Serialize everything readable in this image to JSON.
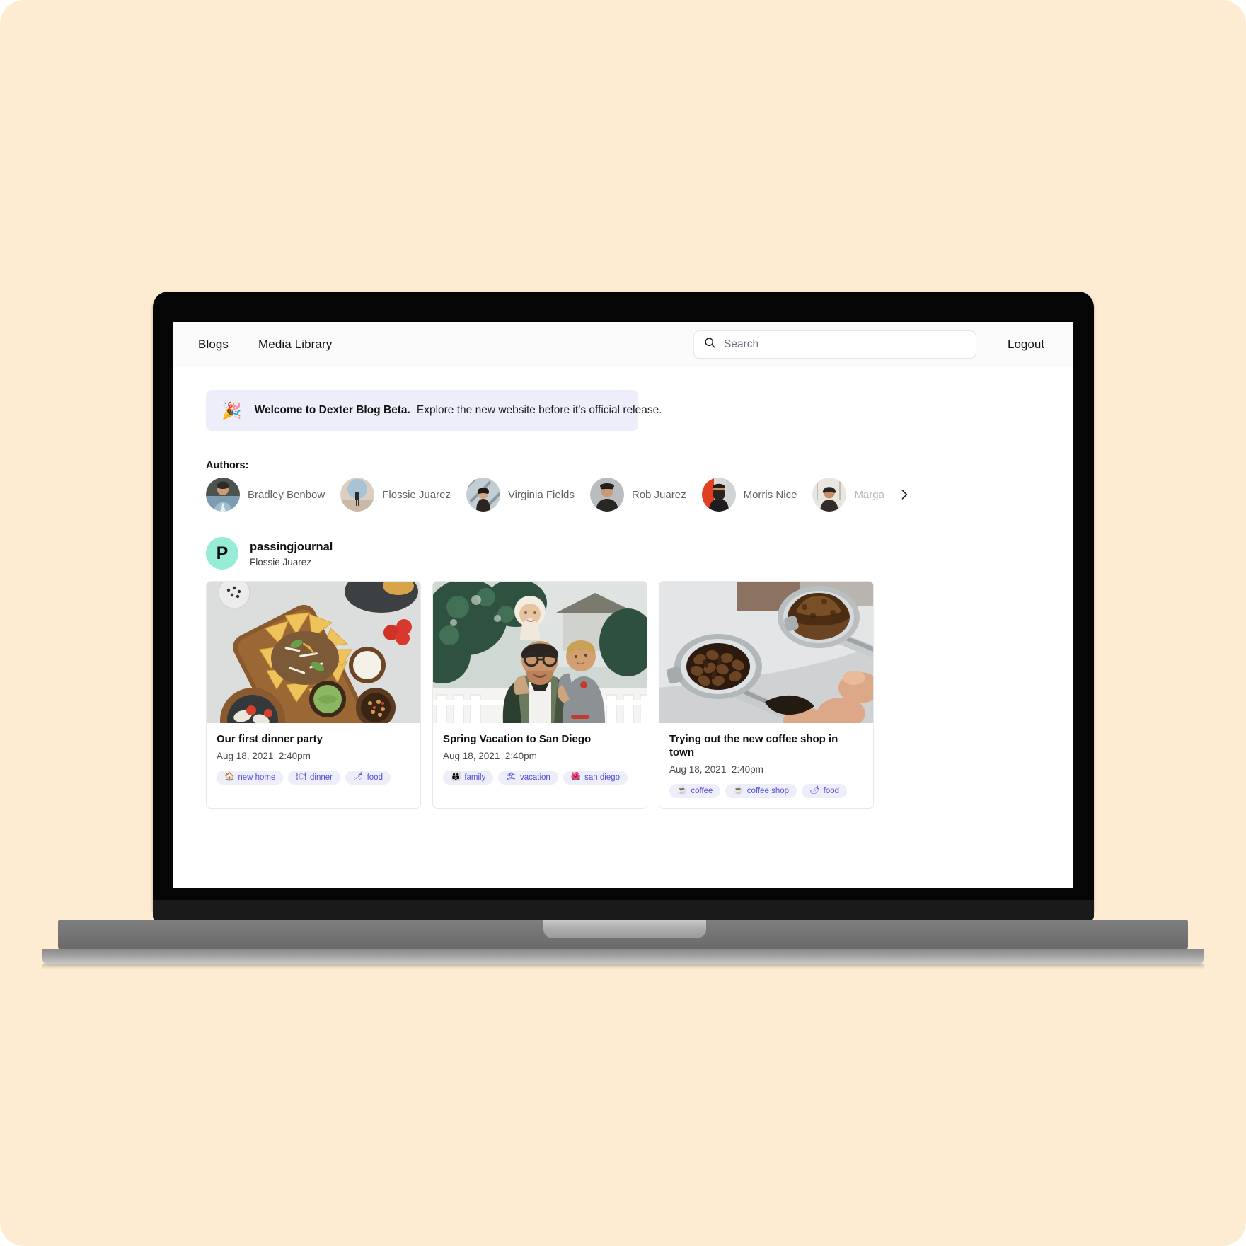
{
  "colors": {
    "page_background": "#fdebd2",
    "banner_background": "#eeeefb",
    "tag_background": "#eeeefb",
    "tag_text": "#5250d6",
    "blog_avatar": "#97ecd8",
    "navbar_background": "#fafafa"
  },
  "navbar": {
    "links": [
      {
        "label": "Blogs",
        "name": "nav-link-blogs"
      },
      {
        "label": "Media Library",
        "name": "nav-link-media-library"
      }
    ],
    "search": {
      "placeholder": "Search",
      "value": "",
      "icon": "search-icon"
    },
    "logout_label": "Logout"
  },
  "banner": {
    "icon": "party-popper-icon",
    "emoji": "🎉",
    "title": "Welcome to Dexter Blog Beta.",
    "message": "Explore the new website before it’s official release."
  },
  "authors": {
    "label": "Authors:",
    "items": [
      {
        "name": "Bradley Benbow",
        "faded": false
      },
      {
        "name": "Flossie Juarez",
        "faded": false
      },
      {
        "name": "Virginia Fields",
        "faded": false
      },
      {
        "name": "Rob Juarez",
        "faded": false
      },
      {
        "name": "Morris Nice",
        "faded": false
      },
      {
        "name": "Margaret Juarez",
        "faded": true
      }
    ],
    "next_icon": "chevron-right-icon"
  },
  "blog": {
    "avatar_initial": "P",
    "name": "passingjournal",
    "author": "Flossie Juarez"
  },
  "posts": [
    {
      "image_alt": "nachos-board-photo",
      "title": "Our first dinner party",
      "date": "Aug 18, 2021",
      "time": "2:40pm",
      "tags": [
        {
          "emoji": "🏠",
          "label": "new home"
        },
        {
          "emoji": "🍽",
          "label": "dinner"
        },
        {
          "emoji": "🌶",
          "label": "food"
        }
      ]
    },
    {
      "image_alt": "father-with-children-photo",
      "title": "Spring Vacation to San Diego",
      "date": "Aug 18, 2021",
      "time": "2:40pm",
      "tags": [
        {
          "emoji": "👪",
          "label": "family"
        },
        {
          "emoji": "🏖",
          "label": "vacation"
        },
        {
          "emoji": "🌺",
          "label": "san diego"
        }
      ]
    },
    {
      "image_alt": "espresso-portafilters-photo",
      "title": "Trying out the new coffee shop in town",
      "date": "Aug 18, 2021",
      "time": "2:40pm",
      "tags": [
        {
          "emoji": "☕",
          "label": "coffee"
        },
        {
          "emoji": "☕",
          "label": "coffee shop"
        },
        {
          "emoji": "🌶",
          "label": "food"
        }
      ]
    }
  ]
}
